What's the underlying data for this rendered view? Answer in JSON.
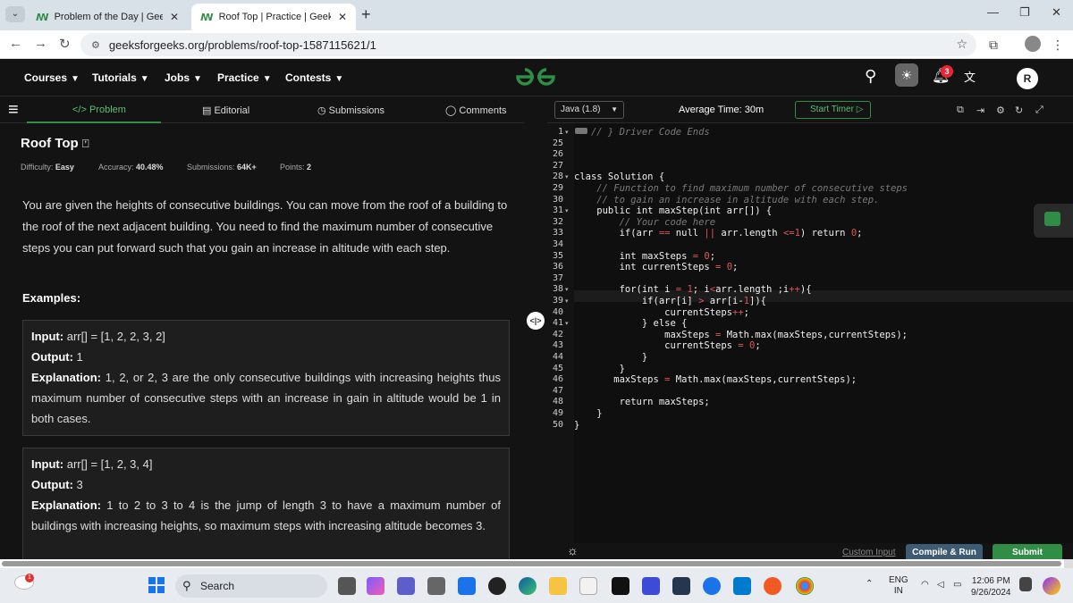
{
  "browser": {
    "tabs": [
      {
        "label": "Problem of the Day | GeeksforG",
        "active": false
      },
      {
        "label": "Roof Top | Practice | GeeksforGe",
        "active": true
      }
    ],
    "url": "geeksforgeeks.org/problems/roof-top-1587115621/1"
  },
  "header": {
    "nav": [
      "Courses",
      "Tutorials",
      "Jobs",
      "Practice",
      "Contests"
    ],
    "logo": "ꟿ",
    "notification_count": "3",
    "avatar_letter": "R"
  },
  "left_tabs": [
    "</> Problem",
    "Editorial",
    "Submissions",
    "Comments"
  ],
  "problem": {
    "title": "Roof Top",
    "difficulty_label": "Difficulty:",
    "difficulty": "Easy",
    "accuracy_label": "Accuracy:",
    "accuracy": "40.48%",
    "submissions_label": "Submissions:",
    "submissions": "64K+",
    "points_label": "Points:",
    "points": "2",
    "description": "You are given the heights of consecutive buildings. You can move from the roof of a building to the roof of the next adjacent building. You need to find the maximum number of consecutive steps you can put forward such that you gain an increase in altitude with each step.",
    "examples_heading": "Examples:",
    "examples": [
      {
        "input_label": "Input:",
        "input": "arr[] = [1, 2, 2, 3, 2]",
        "output_label": "Output:",
        "output": "1",
        "explanation_label": "Explanation:",
        "explanation": "1, 2, or 2, 3 are the only consecutive buildings with increasing heights thus maximum number of consecutive steps with an increase in gain in altitude would be 1 in both cases."
      },
      {
        "input_label": "Input:",
        "input": "arr[] = [1, 2, 3, 4]",
        "output_label": "Output:",
        "output": "3",
        "explanation_label": "Explanation:",
        "explanation": "1 to 2 to 3 to 4 is the jump of length 3 to have a maximum number of buildings with increasing heights, so maximum steps with increasing altitude becomes 3."
      }
    ]
  },
  "editor": {
    "language": "Java (1.8)",
    "average_time": "Average Time: 30m",
    "timer_label": "Start Timer",
    "line_numbers": [
      "1",
      "25",
      "26",
      "27",
      "28",
      "29",
      "30",
      "31",
      "32",
      "33",
      "34",
      "35",
      "36",
      "37",
      "38",
      "39",
      "40",
      "41",
      "42",
      "43",
      "44",
      "45",
      "46",
      "47",
      "48",
      "49",
      "50"
    ],
    "code_lines": [
      "   // } Driver Code Ends",
      "",
      "",
      "",
      "class Solution {",
      "    // Function to find maximum number of consecutive steps",
      "    // to gain an increase in altitude with each step.",
      "    public int maxStep(int arr[]) {",
      "        // Your code here",
      "        if(arr == null || arr.length <=1) return 0;",
      "",
      "        int maxSteps = 0;",
      "        int currentSteps = 0;",
      "",
      "        for(int i = 1; i<arr.length ;i++){",
      "            if(arr[i] > arr[i-1]){",
      "                currentSteps++;",
      "            } else {",
      "                maxSteps = Math.max(maxSteps,currentSteps);",
      "                currentSteps = 0;",
      "            }",
      "        }",
      "       maxSteps = Math.max(maxSteps,currentSteps);",
      "",
      "        return maxSteps;",
      "    }",
      "}"
    ],
    "custom_input": "Custom Input",
    "compile_run": "Compile & Run",
    "submit": "Submit"
  },
  "taskbar": {
    "search": "Search",
    "lang_top": "ENG",
    "lang_bottom": "IN",
    "time": "12:06 PM",
    "date": "9/26/2024",
    "weather_badge": "1"
  }
}
